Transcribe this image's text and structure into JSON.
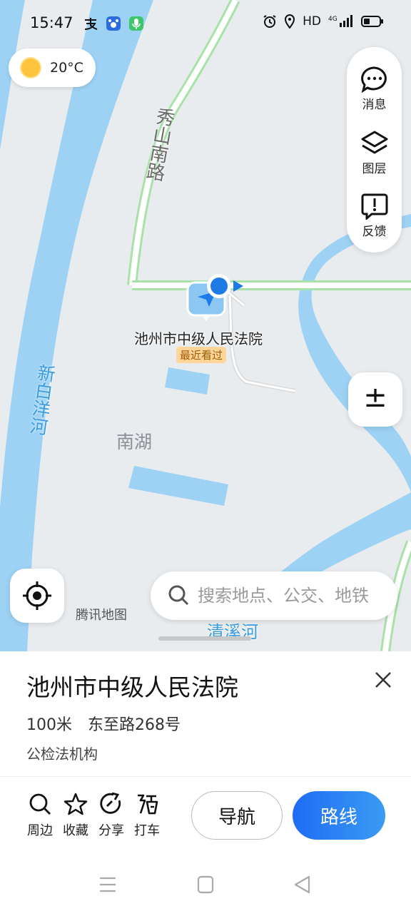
{
  "status_bar": {
    "time": "15:47",
    "right_text": "HD",
    "icons": [
      "alipay-icon",
      "baidu-icon",
      "voice-icon",
      "alarm-icon",
      "location-icon",
      "signal-4g-icon",
      "battery-icon"
    ]
  },
  "weather": {
    "temperature": "20°C",
    "icon": "sun-icon"
  },
  "map": {
    "road_label": "秀山南路",
    "river_label_left": "新白洋河",
    "lake_label": "南湖",
    "river_label_bottom": "清溪河",
    "brand": "腾讯地图",
    "poi": {
      "name": "池州市中级人民法院",
      "tag": "最近看过"
    },
    "colors": {
      "water": "#9dd2f5",
      "land": "#e9ecef",
      "road": "#ffffff",
      "road_edge": "#a8e2a8",
      "location": "#1e7be6"
    }
  },
  "right_panel": [
    {
      "label": "消息",
      "icon": "message-icon"
    },
    {
      "label": "图层",
      "icon": "layers-icon"
    },
    {
      "label": "反馈",
      "icon": "feedback-icon"
    }
  ],
  "zoom": {
    "symbol": "±"
  },
  "search": {
    "placeholder": "搜索地点、公交、地铁"
  },
  "place": {
    "title": "池州市中级人民法院",
    "distance_address": "100米　东至路268号",
    "category": "公检法机构"
  },
  "actions": [
    {
      "label": "周边",
      "icon": "search-icon"
    },
    {
      "label": "收藏",
      "icon": "star-icon"
    },
    {
      "label": "分享",
      "icon": "share-icon"
    },
    {
      "label": "打车",
      "icon": "taxi-icon"
    }
  ],
  "buttons": {
    "navigate": "导航",
    "route": "路线",
    "route_color": "#1f6cf5"
  }
}
